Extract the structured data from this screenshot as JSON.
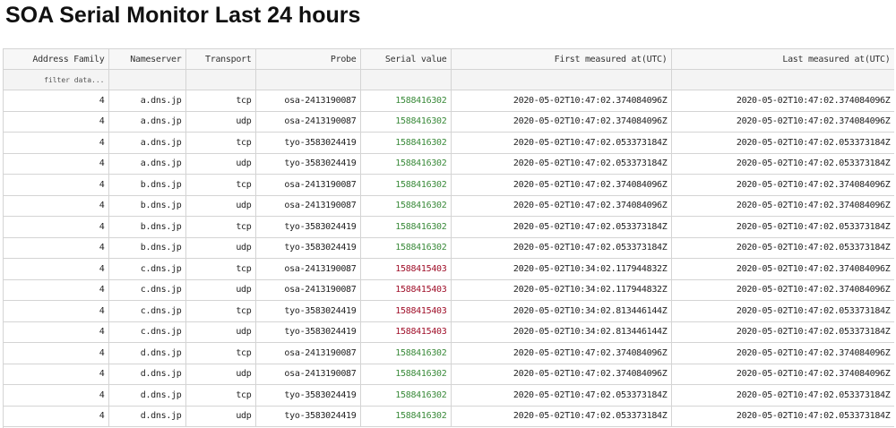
{
  "page": {
    "title": "SOA Serial Monitor Last 24 hours"
  },
  "table": {
    "columns": [
      "Address Family",
      "Nameserver",
      "Transport",
      "Probe",
      "Serial value",
      "First measured at(UTC)",
      "Last measured at(UTC)"
    ],
    "filter_placeholder": "filter data...",
    "serial_colors": {
      "ok": "#3a8a3a",
      "mismatch": "#a0102a"
    },
    "rows": [
      {
        "af": "4",
        "ns": "a.dns.jp",
        "transport": "tcp",
        "probe": "osa-2413190087",
        "serial": "1588416302",
        "status": "ok",
        "first": "2020-05-02T10:47:02.374084096Z",
        "last": "2020-05-02T10:47:02.374084096Z"
      },
      {
        "af": "4",
        "ns": "a.dns.jp",
        "transport": "udp",
        "probe": "osa-2413190087",
        "serial": "1588416302",
        "status": "ok",
        "first": "2020-05-02T10:47:02.374084096Z",
        "last": "2020-05-02T10:47:02.374084096Z"
      },
      {
        "af": "4",
        "ns": "a.dns.jp",
        "transport": "tcp",
        "probe": "tyo-3583024419",
        "serial": "1588416302",
        "status": "ok",
        "first": "2020-05-02T10:47:02.053373184Z",
        "last": "2020-05-02T10:47:02.053373184Z"
      },
      {
        "af": "4",
        "ns": "a.dns.jp",
        "transport": "udp",
        "probe": "tyo-3583024419",
        "serial": "1588416302",
        "status": "ok",
        "first": "2020-05-02T10:47:02.053373184Z",
        "last": "2020-05-02T10:47:02.053373184Z"
      },
      {
        "af": "4",
        "ns": "b.dns.jp",
        "transport": "tcp",
        "probe": "osa-2413190087",
        "serial": "1588416302",
        "status": "ok",
        "first": "2020-05-02T10:47:02.374084096Z",
        "last": "2020-05-02T10:47:02.374084096Z"
      },
      {
        "af": "4",
        "ns": "b.dns.jp",
        "transport": "udp",
        "probe": "osa-2413190087",
        "serial": "1588416302",
        "status": "ok",
        "first": "2020-05-02T10:47:02.374084096Z",
        "last": "2020-05-02T10:47:02.374084096Z"
      },
      {
        "af": "4",
        "ns": "b.dns.jp",
        "transport": "tcp",
        "probe": "tyo-3583024419",
        "serial": "1588416302",
        "status": "ok",
        "first": "2020-05-02T10:47:02.053373184Z",
        "last": "2020-05-02T10:47:02.053373184Z"
      },
      {
        "af": "4",
        "ns": "b.dns.jp",
        "transport": "udp",
        "probe": "tyo-3583024419",
        "serial": "1588416302",
        "status": "ok",
        "first": "2020-05-02T10:47:02.053373184Z",
        "last": "2020-05-02T10:47:02.053373184Z"
      },
      {
        "af": "4",
        "ns": "c.dns.jp",
        "transport": "tcp",
        "probe": "osa-2413190087",
        "serial": "1588415403",
        "status": "mismatch",
        "first": "2020-05-02T10:34:02.117944832Z",
        "last": "2020-05-02T10:47:02.374084096Z"
      },
      {
        "af": "4",
        "ns": "c.dns.jp",
        "transport": "udp",
        "probe": "osa-2413190087",
        "serial": "1588415403",
        "status": "mismatch",
        "first": "2020-05-02T10:34:02.117944832Z",
        "last": "2020-05-02T10:47:02.374084096Z"
      },
      {
        "af": "4",
        "ns": "c.dns.jp",
        "transport": "tcp",
        "probe": "tyo-3583024419",
        "serial": "1588415403",
        "status": "mismatch",
        "first": "2020-05-02T10:34:02.813446144Z",
        "last": "2020-05-02T10:47:02.053373184Z"
      },
      {
        "af": "4",
        "ns": "c.dns.jp",
        "transport": "udp",
        "probe": "tyo-3583024419",
        "serial": "1588415403",
        "status": "mismatch",
        "first": "2020-05-02T10:34:02.813446144Z",
        "last": "2020-05-02T10:47:02.053373184Z"
      },
      {
        "af": "4",
        "ns": "d.dns.jp",
        "transport": "tcp",
        "probe": "osa-2413190087",
        "serial": "1588416302",
        "status": "ok",
        "first": "2020-05-02T10:47:02.374084096Z",
        "last": "2020-05-02T10:47:02.374084096Z"
      },
      {
        "af": "4",
        "ns": "d.dns.jp",
        "transport": "udp",
        "probe": "osa-2413190087",
        "serial": "1588416302",
        "status": "ok",
        "first": "2020-05-02T10:47:02.374084096Z",
        "last": "2020-05-02T10:47:02.374084096Z"
      },
      {
        "af": "4",
        "ns": "d.dns.jp",
        "transport": "tcp",
        "probe": "tyo-3583024419",
        "serial": "1588416302",
        "status": "ok",
        "first": "2020-05-02T10:47:02.053373184Z",
        "last": "2020-05-02T10:47:02.053373184Z"
      },
      {
        "af": "4",
        "ns": "d.dns.jp",
        "transport": "udp",
        "probe": "tyo-3583024419",
        "serial": "1588416302",
        "status": "ok",
        "first": "2020-05-02T10:47:02.053373184Z",
        "last": "2020-05-02T10:47:02.053373184Z"
      }
    ]
  }
}
